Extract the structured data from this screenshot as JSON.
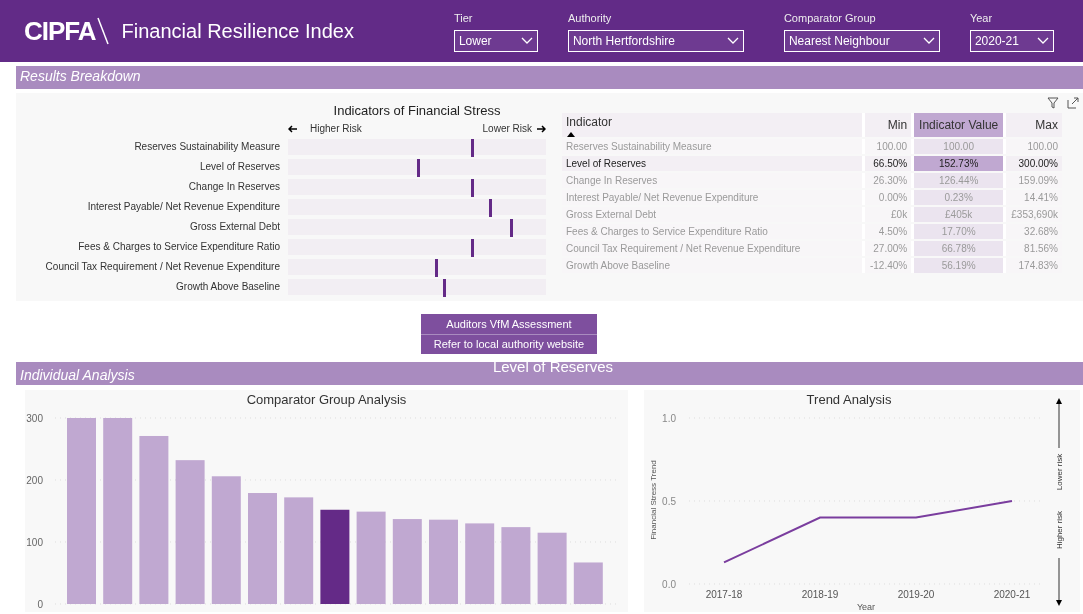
{
  "header": {
    "logo": "CIPFA",
    "title": "Financial Resilience Index",
    "filters": [
      {
        "label": "Tier",
        "value": "Lower"
      },
      {
        "label": "Authority",
        "value": "North Hertfordshire"
      },
      {
        "label": "Comparator Group",
        "value": "Nearest Neighbour"
      },
      {
        "label": "Year",
        "value": "2020-21"
      }
    ]
  },
  "results_section": {
    "title": "Results Breakdown"
  },
  "stress_chart": {
    "title": "Indicators of Financial Stress",
    "left_label": "Higher Risk",
    "right_label": "Lower Risk",
    "indicators": [
      {
        "name": "Reserves Sustainability Measure",
        "level": 0.71
      },
      {
        "name": "Level of Reserves",
        "level": 0.5
      },
      {
        "name": "Change In Reserves",
        "level": 0.71
      },
      {
        "name": "Interest Payable/ Net Revenue Expenditure",
        "level": 0.78
      },
      {
        "name": "Gross External Debt",
        "level": 0.86
      },
      {
        "name": "Fees & Charges to Service Expenditure Ratio",
        "level": 0.71
      },
      {
        "name": "Council Tax Requirement / Net Revenue Expenditure",
        "level": 0.57
      },
      {
        "name": "Growth Above Baseline",
        "level": 0.6
      }
    ]
  },
  "table": {
    "columns": [
      "Indicator",
      "Min",
      "Indicator Value",
      "Max"
    ],
    "rows": [
      {
        "selected": false,
        "cells": [
          "Reserves Sustainability Measure",
          "100.00",
          "100.00",
          "100.00"
        ]
      },
      {
        "selected": true,
        "cells": [
          "Level of Reserves",
          "66.50%",
          "152.73%",
          "300.00%"
        ]
      },
      {
        "selected": false,
        "cells": [
          "Change In Reserves",
          "26.30%",
          "126.44%",
          "159.09%"
        ]
      },
      {
        "selected": false,
        "cells": [
          "Interest Payable/ Net Revenue Expenditure",
          "0.00%",
          "0.23%",
          "14.41%"
        ]
      },
      {
        "selected": false,
        "cells": [
          "Gross External Debt",
          "£0k",
          "£405k",
          "£353,690k"
        ]
      },
      {
        "selected": false,
        "cells": [
          "Fees & Charges to Service Expenditure Ratio",
          "4.50%",
          "17.70%",
          "32.68%"
        ]
      },
      {
        "selected": false,
        "cells": [
          "Council Tax Requirement / Net Revenue Expenditure",
          "27.00%",
          "66.78%",
          "81.56%"
        ]
      },
      {
        "selected": false,
        "cells": [
          "Growth Above Baseline",
          "-12.40%",
          "56.19%",
          "174.83%"
        ]
      }
    ]
  },
  "buttons": [
    "Auditors VfM Assessment",
    "Refer to local authority website"
  ],
  "analysis_section": {
    "title": "Individual Analysis",
    "indicator": "Level of Reserves"
  },
  "comparator_chart": {
    "chart_data": {
      "type": "bar",
      "title": "Comparator Group Analysis",
      "values": [
        300,
        300,
        271,
        232,
        206,
        179,
        172,
        152,
        149,
        137,
        136,
        130,
        124,
        115,
        67
      ],
      "colors": [
        "#c0a8d1",
        "#c0a8d1",
        "#c0a8d1",
        "#c0a8d1",
        "#c0a8d1",
        "#c0a8d1",
        "#c0a8d1",
        "#642a87",
        "#c0a8d1",
        "#c0a8d1",
        "#c0a8d1",
        "#c0a8d1",
        "#c0a8d1",
        "#c0a8d1",
        "#c0a8d1"
      ],
      "ylim": [
        0,
        300
      ],
      "yticks": [
        0,
        100,
        200,
        300
      ]
    }
  },
  "trend_chart": {
    "chart_data": {
      "type": "line",
      "title": "Trend Analysis",
      "xlabel": "Year",
      "ylabel": "Financial Stress Trend",
      "categories": [
        "2017-18",
        "2018-19",
        "2019-20",
        "2020-21"
      ],
      "series": [
        {
          "color": "#7a3d9e",
          "values": [
            0.13,
            0.4,
            0.4,
            0.5
          ]
        }
      ],
      "ylim": [
        0,
        1
      ],
      "yticks": [
        {
          "value": 0,
          "label": "0.0"
        },
        {
          "value": 0.5,
          "label": "0.5"
        },
        {
          "value": 1,
          "label": "1.0"
        }
      ]
    },
    "side_labels": [
      "Lower risk",
      "Higher risk"
    ]
  }
}
